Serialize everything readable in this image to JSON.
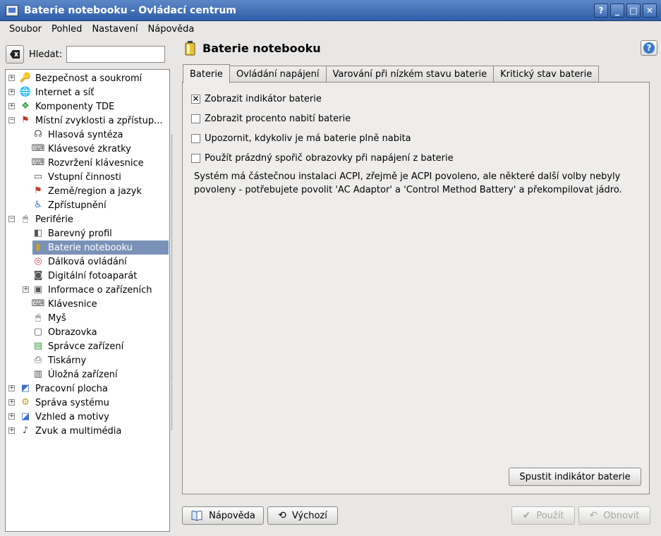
{
  "window": {
    "title": "Baterie notebooku - Ovládací centrum"
  },
  "titlebar_buttons": [
    "?",
    "_",
    "□",
    "✕"
  ],
  "menu": [
    "Soubor",
    "Pohled",
    "Nastavení",
    "Nápověda"
  ],
  "search": {
    "label": "Hledat:",
    "value": ""
  },
  "tree": [
    {
      "label": "Bezpečnost a soukromí",
      "level": 0,
      "expander": "+",
      "icon": "key-icon"
    },
    {
      "label": "Internet a síť",
      "level": 0,
      "expander": "+",
      "icon": "globe-icon"
    },
    {
      "label": "Komponenty TDE",
      "level": 0,
      "expander": "+",
      "icon": "components-icon"
    },
    {
      "label": "Místní zvyklosti a zpřístup...",
      "level": 0,
      "expander": "−",
      "icon": "flag-icon"
    },
    {
      "label": "Hlasová syntéza",
      "level": 1,
      "icon": "speech-icon"
    },
    {
      "label": "Klávesové zkratky",
      "level": 1,
      "icon": "shortcut-icon"
    },
    {
      "label": "Rozvržení klávesnice",
      "level": 1,
      "icon": "keyboard-icon"
    },
    {
      "label": "Vstupní činnosti",
      "level": 1,
      "icon": "input-icon"
    },
    {
      "label": "Země/region a jazyk",
      "level": 1,
      "icon": "country-flag-icon"
    },
    {
      "label": "Zpřístupnění",
      "level": 1,
      "icon": "accessibility-icon"
    },
    {
      "label": "Periférie",
      "level": 0,
      "expander": "−",
      "icon": "mouse-icon"
    },
    {
      "label": "Barevný profil",
      "level": 1,
      "icon": "color-profile-icon"
    },
    {
      "label": "Baterie notebooku",
      "level": 1,
      "icon": "battery-icon",
      "selected": true
    },
    {
      "label": "Dálková ovládání",
      "level": 1,
      "icon": "remote-icon"
    },
    {
      "label": "Digitální fotoaparát",
      "level": 1,
      "icon": "camera-icon"
    },
    {
      "label": "Informace o zařízeních",
      "level": 1,
      "expander": "+",
      "icon": "device-info-icon"
    },
    {
      "label": "Klávesnice",
      "level": 1,
      "icon": "keyboard-icon"
    },
    {
      "label": "Myš",
      "level": 1,
      "icon": "mouse-icon"
    },
    {
      "label": "Obrazovka",
      "level": 1,
      "icon": "display-icon"
    },
    {
      "label": "Správce zařízení",
      "level": 1,
      "icon": "device-manager-icon"
    },
    {
      "label": "Tiskárny",
      "level": 1,
      "icon": "printer-icon"
    },
    {
      "label": "Úložná zařízení",
      "level": 1,
      "icon": "storage-icon"
    },
    {
      "label": "Pracovní plocha",
      "level": 0,
      "expander": "+",
      "icon": "desktop-icon"
    },
    {
      "label": "Správa systému",
      "level": 0,
      "expander": "+",
      "icon": "system-icon"
    },
    {
      "label": "Vzhled a motivy",
      "level": 0,
      "expander": "+",
      "icon": "appearance-icon"
    },
    {
      "label": "Zvuk a multimédia",
      "level": 0,
      "expander": "+",
      "icon": "sound-icon"
    }
  ],
  "module": {
    "title": "Baterie notebooku"
  },
  "tabs": [
    "Baterie",
    "Ovládání napájení",
    "Varování při nízkém stavu baterie",
    "Kritický stav baterie"
  ],
  "checkboxes": [
    {
      "label": "Zobrazit indikátor baterie",
      "checked": true
    },
    {
      "label": "Zobrazit procento nabití baterie",
      "checked": false
    },
    {
      "label": "Upozornit, kdykoliv je má baterie plně nabita",
      "checked": false
    },
    {
      "label": "Použít prázdný spořič obrazovky při napájení z baterie",
      "checked": false
    }
  ],
  "info": "Systém má částečnou instalaci ACPI, zřejmě je ACPI povoleno, ale některé další volby nebyly povoleny - potřebujete povolit 'AC Adaptor' a 'Control Method Battery' a překompilovat jádro.",
  "buttons": {
    "start_indicator": "Spustit indikátor baterie",
    "help": "Nápověda",
    "defaults": "Výchozí",
    "apply": "Použít",
    "reset": "Obnovit"
  },
  "colors": {
    "titlebar": "#2f5ea8",
    "selection": "#7b92b8",
    "window_bg": "#e8e7e6"
  }
}
